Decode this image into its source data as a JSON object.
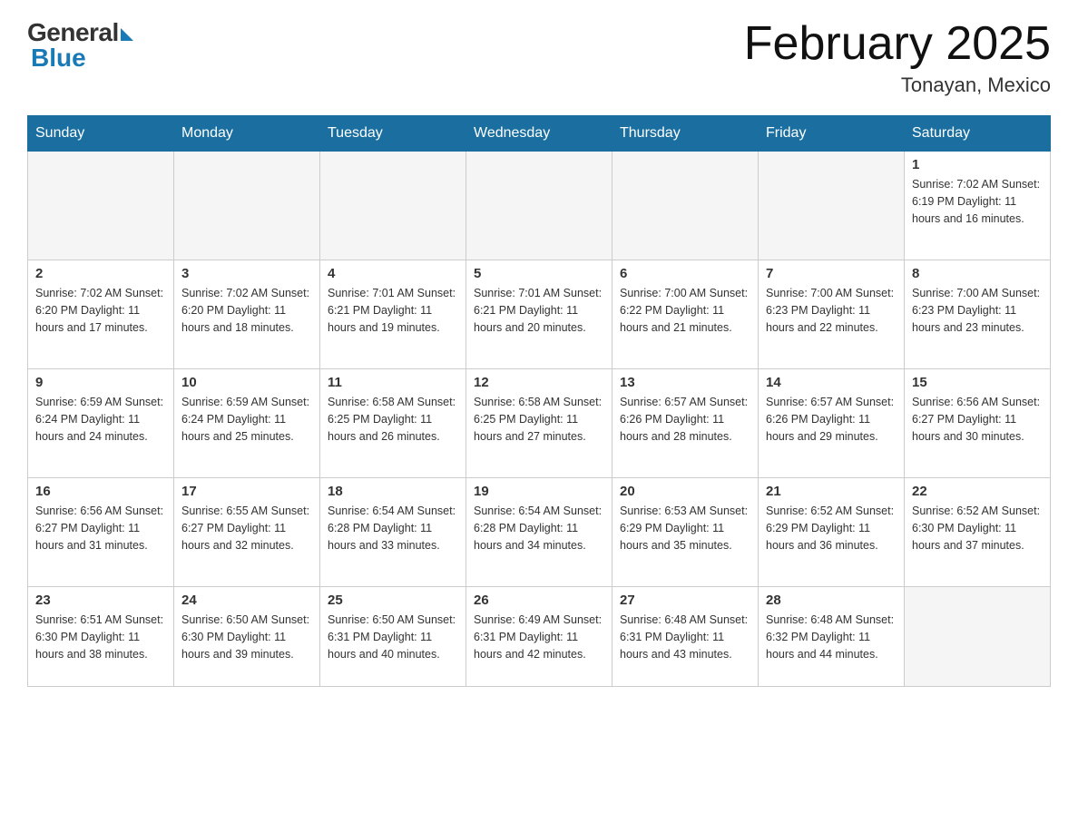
{
  "header": {
    "logo_general": "General",
    "logo_blue": "Blue",
    "month_title": "February 2025",
    "location": "Tonayan, Mexico"
  },
  "days_of_week": [
    "Sunday",
    "Monday",
    "Tuesday",
    "Wednesday",
    "Thursday",
    "Friday",
    "Saturday"
  ],
  "weeks": [
    [
      {
        "day": "",
        "info": ""
      },
      {
        "day": "",
        "info": ""
      },
      {
        "day": "",
        "info": ""
      },
      {
        "day": "",
        "info": ""
      },
      {
        "day": "",
        "info": ""
      },
      {
        "day": "",
        "info": ""
      },
      {
        "day": "1",
        "info": "Sunrise: 7:02 AM\nSunset: 6:19 PM\nDaylight: 11 hours\nand 16 minutes."
      }
    ],
    [
      {
        "day": "2",
        "info": "Sunrise: 7:02 AM\nSunset: 6:20 PM\nDaylight: 11 hours\nand 17 minutes."
      },
      {
        "day": "3",
        "info": "Sunrise: 7:02 AM\nSunset: 6:20 PM\nDaylight: 11 hours\nand 18 minutes."
      },
      {
        "day": "4",
        "info": "Sunrise: 7:01 AM\nSunset: 6:21 PM\nDaylight: 11 hours\nand 19 minutes."
      },
      {
        "day": "5",
        "info": "Sunrise: 7:01 AM\nSunset: 6:21 PM\nDaylight: 11 hours\nand 20 minutes."
      },
      {
        "day": "6",
        "info": "Sunrise: 7:00 AM\nSunset: 6:22 PM\nDaylight: 11 hours\nand 21 minutes."
      },
      {
        "day": "7",
        "info": "Sunrise: 7:00 AM\nSunset: 6:23 PM\nDaylight: 11 hours\nand 22 minutes."
      },
      {
        "day": "8",
        "info": "Sunrise: 7:00 AM\nSunset: 6:23 PM\nDaylight: 11 hours\nand 23 minutes."
      }
    ],
    [
      {
        "day": "9",
        "info": "Sunrise: 6:59 AM\nSunset: 6:24 PM\nDaylight: 11 hours\nand 24 minutes."
      },
      {
        "day": "10",
        "info": "Sunrise: 6:59 AM\nSunset: 6:24 PM\nDaylight: 11 hours\nand 25 minutes."
      },
      {
        "day": "11",
        "info": "Sunrise: 6:58 AM\nSunset: 6:25 PM\nDaylight: 11 hours\nand 26 minutes."
      },
      {
        "day": "12",
        "info": "Sunrise: 6:58 AM\nSunset: 6:25 PM\nDaylight: 11 hours\nand 27 minutes."
      },
      {
        "day": "13",
        "info": "Sunrise: 6:57 AM\nSunset: 6:26 PM\nDaylight: 11 hours\nand 28 minutes."
      },
      {
        "day": "14",
        "info": "Sunrise: 6:57 AM\nSunset: 6:26 PM\nDaylight: 11 hours\nand 29 minutes."
      },
      {
        "day": "15",
        "info": "Sunrise: 6:56 AM\nSunset: 6:27 PM\nDaylight: 11 hours\nand 30 minutes."
      }
    ],
    [
      {
        "day": "16",
        "info": "Sunrise: 6:56 AM\nSunset: 6:27 PM\nDaylight: 11 hours\nand 31 minutes."
      },
      {
        "day": "17",
        "info": "Sunrise: 6:55 AM\nSunset: 6:27 PM\nDaylight: 11 hours\nand 32 minutes."
      },
      {
        "day": "18",
        "info": "Sunrise: 6:54 AM\nSunset: 6:28 PM\nDaylight: 11 hours\nand 33 minutes."
      },
      {
        "day": "19",
        "info": "Sunrise: 6:54 AM\nSunset: 6:28 PM\nDaylight: 11 hours\nand 34 minutes."
      },
      {
        "day": "20",
        "info": "Sunrise: 6:53 AM\nSunset: 6:29 PM\nDaylight: 11 hours\nand 35 minutes."
      },
      {
        "day": "21",
        "info": "Sunrise: 6:52 AM\nSunset: 6:29 PM\nDaylight: 11 hours\nand 36 minutes."
      },
      {
        "day": "22",
        "info": "Sunrise: 6:52 AM\nSunset: 6:30 PM\nDaylight: 11 hours\nand 37 minutes."
      }
    ],
    [
      {
        "day": "23",
        "info": "Sunrise: 6:51 AM\nSunset: 6:30 PM\nDaylight: 11 hours\nand 38 minutes."
      },
      {
        "day": "24",
        "info": "Sunrise: 6:50 AM\nSunset: 6:30 PM\nDaylight: 11 hours\nand 39 minutes."
      },
      {
        "day": "25",
        "info": "Sunrise: 6:50 AM\nSunset: 6:31 PM\nDaylight: 11 hours\nand 40 minutes."
      },
      {
        "day": "26",
        "info": "Sunrise: 6:49 AM\nSunset: 6:31 PM\nDaylight: 11 hours\nand 42 minutes."
      },
      {
        "day": "27",
        "info": "Sunrise: 6:48 AM\nSunset: 6:31 PM\nDaylight: 11 hours\nand 43 minutes."
      },
      {
        "day": "28",
        "info": "Sunrise: 6:48 AM\nSunset: 6:32 PM\nDaylight: 11 hours\nand 44 minutes."
      },
      {
        "day": "",
        "info": ""
      }
    ]
  ]
}
